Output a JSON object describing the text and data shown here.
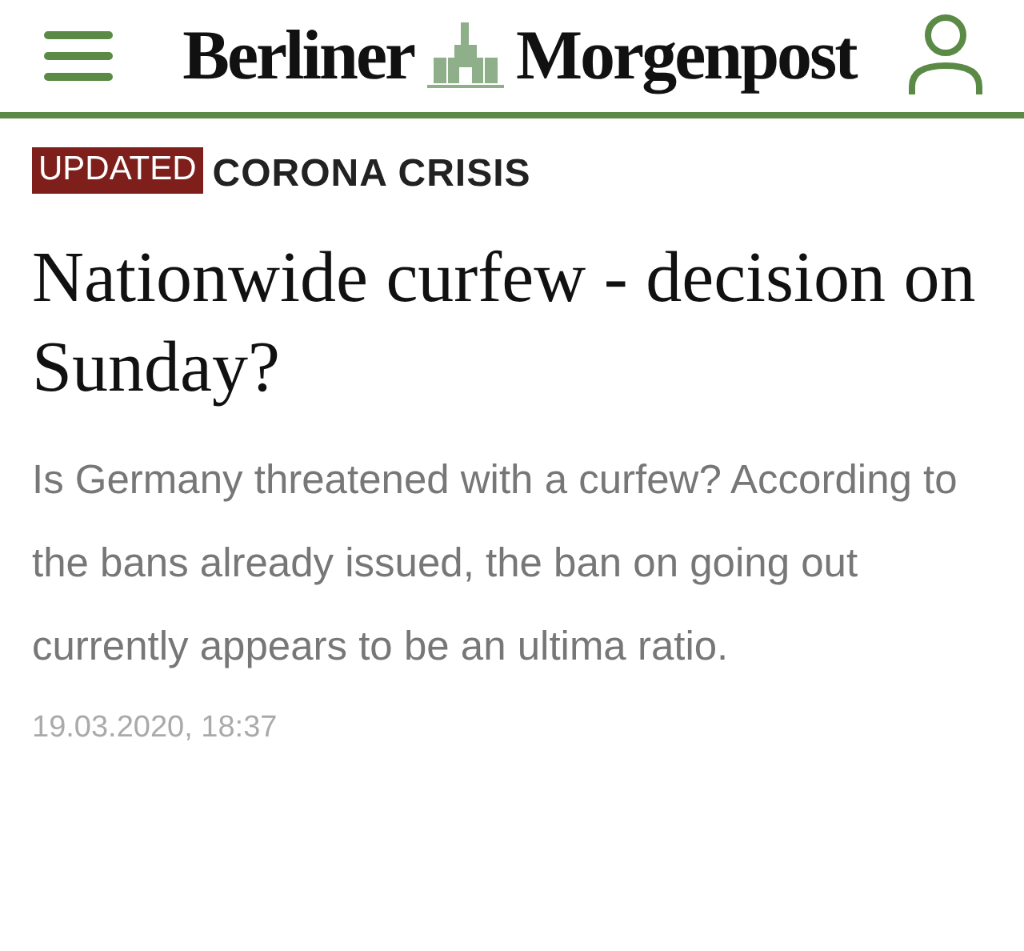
{
  "header": {
    "logo_left": "Berliner",
    "logo_right": "Morgenpost"
  },
  "article": {
    "badge": "UPDATED",
    "kicker": "CORONA CRISIS",
    "headline": "Nationwide curfew - decision on Sunday?",
    "teaser": "Is Germany threatened with a curfew? According to the bans already issued, the ban on going out currently appears to be an ultima ratio.",
    "timestamp": "19.03.2020, 18:37"
  }
}
